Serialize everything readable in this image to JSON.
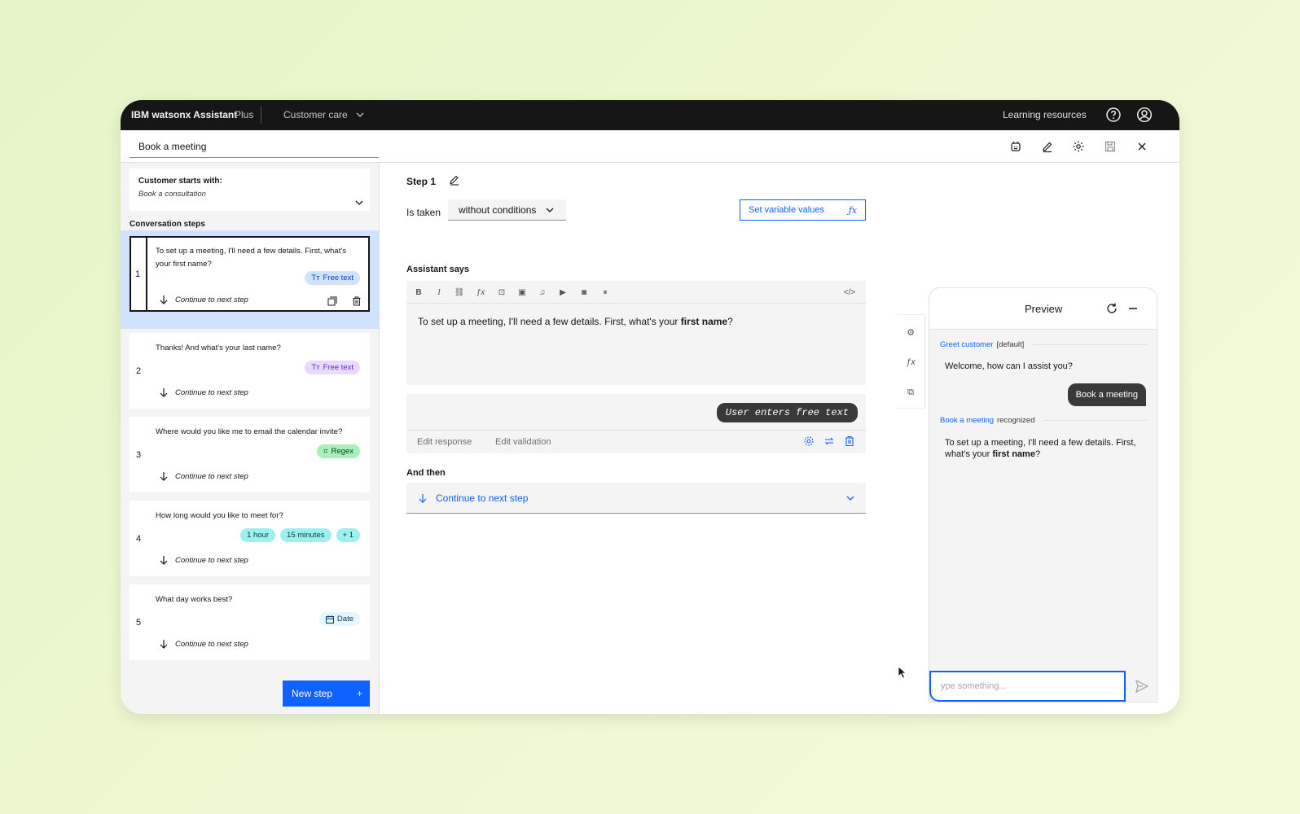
{
  "topbar": {
    "brand": "IBM watsonx Assistant",
    "plan": "Plus",
    "assistant": "Customer care",
    "learning": "Learning resources"
  },
  "header": {
    "action_name": "Book a meeting"
  },
  "sidebar": {
    "starts_label": "Customer starts with:",
    "starts_value": "Book a consultation",
    "steps_heading": "Conversation steps",
    "new_step": "New step",
    "steps": [
      {
        "num": "1",
        "text": "To set up a meeting, I'll need a few details. First, what's your first name?",
        "continue": "Continue to next step",
        "tags": [
          "Free text"
        ]
      },
      {
        "num": "2",
        "text": "Thanks! And what's your last name?",
        "continue": "Continue to next step",
        "tags": [
          "Free text"
        ]
      },
      {
        "num": "3",
        "text": "Where would you like me to email the calendar invite?",
        "continue": "Continue to next step",
        "tags": [
          "Regex"
        ]
      },
      {
        "num": "4",
        "text": "How long would you like to meet for?",
        "continue": "Continue to next step",
        "tags": [
          "1 hour",
          "15 minutes",
          "+ 1"
        ]
      },
      {
        "num": "5",
        "text": "What day works best?",
        "continue": "Continue to next step",
        "tags": [
          "Date"
        ]
      }
    ]
  },
  "editor": {
    "step_title": "Step 1",
    "is_taken": "Is taken",
    "condition": "without conditions",
    "set_vars": "Set variable values",
    "assistant_says": "Assistant says",
    "message_pre": "To set up a meeting, I'll need a few details. First, what's your ",
    "message_bold": "first name",
    "message_post": "?",
    "response_bubble": "User enters free text",
    "edit_response": "Edit response",
    "edit_validation": "Edit validation",
    "and_then": "And then",
    "continue": "Continue to next step"
  },
  "preview": {
    "title": "Preview",
    "greet_link": "Greet customer",
    "greet_tag": "[default]",
    "welcome": "Welcome, how can I assist you?",
    "user_msg": "Book a meeting",
    "recognized_link": "Book a meeting",
    "recognized_tag": "recognized",
    "reply_pre": "To set up a meeting, I'll need a few details. First, what's your ",
    "reply_bold": "first name",
    "reply_post": "?",
    "input_placeholder": "ype something..."
  },
  "colors": {
    "accent": "#0f62fe",
    "topbar": "#161616",
    "selected": "#d0e2ff"
  }
}
